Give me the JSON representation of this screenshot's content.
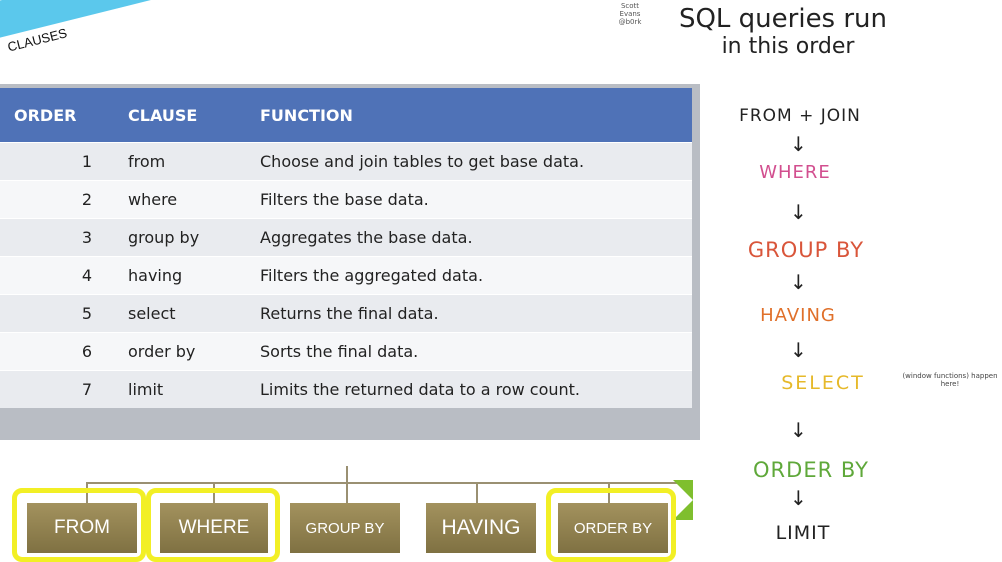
{
  "ribbon": {
    "label": "CLAUSES",
    "color": "#5bc8ec"
  },
  "table": {
    "headers": [
      "ORDER",
      "CLAUSE",
      "FUNCTION"
    ],
    "rows": [
      {
        "order": "1",
        "clause": "from",
        "function": "Choose and join tables to get base data."
      },
      {
        "order": "2",
        "clause": "where",
        "function": "Filters the base data."
      },
      {
        "order": "3",
        "clause": "group by",
        "function": "Aggregates the base data."
      },
      {
        "order": "4",
        "clause": "having",
        "function": "Filters the aggregated data."
      },
      {
        "order": "5",
        "clause": "select",
        "function": "Returns the final data."
      },
      {
        "order": "6",
        "clause": "order by",
        "function": "Sorts the final data."
      },
      {
        "order": "7",
        "clause": "limit",
        "function": "Limits the returned data to a row count."
      }
    ],
    "header_color": "#4f72b7"
  },
  "flow": {
    "boxes": [
      "FROM",
      "WHERE",
      "GROUP BY",
      "HAVING",
      "ORDER BY"
    ],
    "highlight_color": "#f2ef25"
  },
  "sketch": {
    "author": "Scott Evans @b0rk",
    "title_line1": "SQL queries run",
    "title_line2": "in this order",
    "steps": [
      "FROM + JOIN",
      "WHERE",
      "GROUP BY",
      "HAVING",
      "SELECT",
      "ORDER BY",
      "LIMIT"
    ],
    "select_note": "(window functions) happen here!",
    "arrow_glyph": "↓",
    "colors": {
      "from": "#222222",
      "where": "#d24f8f",
      "group_by": "#d9553a",
      "having": "#e0702a",
      "select": "#e6b92a",
      "order_by": "#5fa83a",
      "limit": "#222222"
    }
  }
}
